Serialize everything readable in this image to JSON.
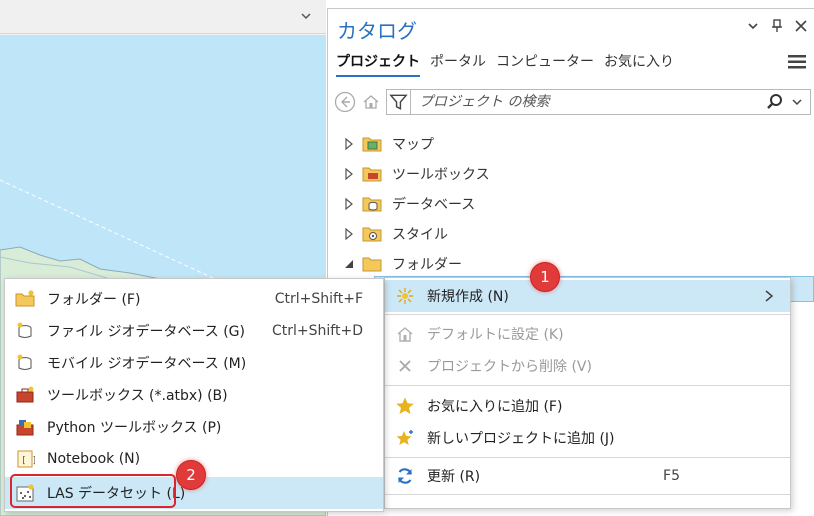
{
  "catalog": {
    "title": "カタログ",
    "tabs": [
      "プロジェクト",
      "ポータル",
      "コンピューター",
      "お気に入り"
    ],
    "search_placeholder": "プロジェクト の検索",
    "tree": [
      {
        "label": "マップ",
        "expanded": false
      },
      {
        "label": "ツールボックス",
        "expanded": false
      },
      {
        "label": "データベース",
        "expanded": false
      },
      {
        "label": "スタイル",
        "expanded": false
      },
      {
        "label": "フォルダー",
        "expanded": true
      }
    ]
  },
  "submenu": {
    "items": [
      {
        "label": "フォルダー (F)",
        "shortcut": "Ctrl+Shift+F"
      },
      {
        "label": "ファイル ジオデータベース (G)",
        "shortcut": "Ctrl+Shift+D"
      },
      {
        "label": "モバイル ジオデータベース (M)",
        "shortcut": ""
      },
      {
        "label": "ツールボックス (*.atbx) (B)",
        "shortcut": ""
      },
      {
        "label": "Python ツールボックス (P)",
        "shortcut": ""
      },
      {
        "label": "Notebook (N)",
        "shortcut": ""
      },
      {
        "label": "LAS データセット (L)",
        "shortcut": ""
      }
    ]
  },
  "context_menu": {
    "new": "新規作成 (N)",
    "set_default": "デフォルトに設定 (K)",
    "remove": "プロジェクトから削除 (V)",
    "add_favorites": "お気に入りに追加 (F)",
    "add_new_projects": "新しいプロジェクトに追加 (J)",
    "refresh": "更新 (R)",
    "refresh_shortcut": "F5"
  },
  "callouts": {
    "one": "1",
    "two": "2"
  },
  "colors": {
    "accent": "#2a72c4",
    "highlight": "#cce8f7",
    "callout": "#e03a3a"
  }
}
